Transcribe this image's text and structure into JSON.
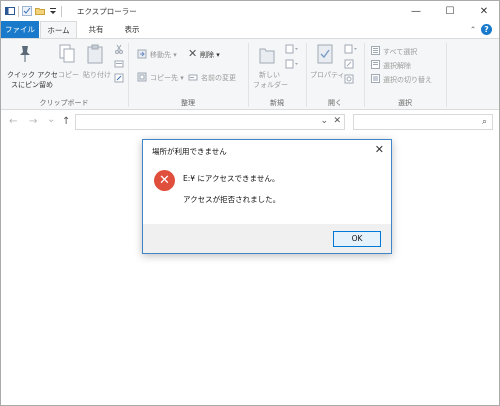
{
  "window": {
    "title": "エクスプローラー",
    "minimize_glyph": "—",
    "maximize_glyph": "☐",
    "close_glyph": "✕"
  },
  "ribbon_tabs": {
    "file": "ファイル",
    "home": "ホーム",
    "share": "共有",
    "view": "表示",
    "help_glyph": "?",
    "collapse_glyph": "⌃"
  },
  "ribbon": {
    "clipboard": {
      "pin_label_line1": "クイック アクセ",
      "pin_label_line2": "スにピン留め",
      "copy_label": "コピー",
      "paste_label": "貼り付け",
      "group_label": "クリップボード"
    },
    "organize": {
      "move_to": "移動先 ▾",
      "copy_to": "コピー先 ▾",
      "delete": "削除 ▾",
      "rename": "名前の変更",
      "group_label": "整理"
    },
    "new": {
      "new_folder_line1": "新しい",
      "new_folder_line2": "フォルダー",
      "group_label": "新規"
    },
    "open": {
      "properties": "プロパティ",
      "group_label": "開く"
    },
    "select": {
      "select_all": "すべて選択",
      "select_none": "選択解除",
      "invert_selection": "選択の切り替え",
      "group_label": "選択"
    }
  },
  "nav": {
    "back_glyph": "←",
    "forward_glyph": "→",
    "recent_glyph": "⌄",
    "up_glyph": "↑",
    "address_value": "",
    "address_dropdown_glyph": "⌄",
    "address_clear_glyph": "✕",
    "search_placeholder": "",
    "search_glyph": "⌕"
  },
  "dialog": {
    "title": "場所が利用できません",
    "close_glyph": "✕",
    "error_glyph": "✕",
    "message_line1": "E:¥ にアクセスできません。",
    "message_line2": "アクセスが拒否されました。",
    "ok_label": "OK"
  },
  "colors": {
    "accent": "#1979ca",
    "error": "#e04f3c",
    "dialog_border": "#3e86c8",
    "ok_border": "#0078d7"
  }
}
